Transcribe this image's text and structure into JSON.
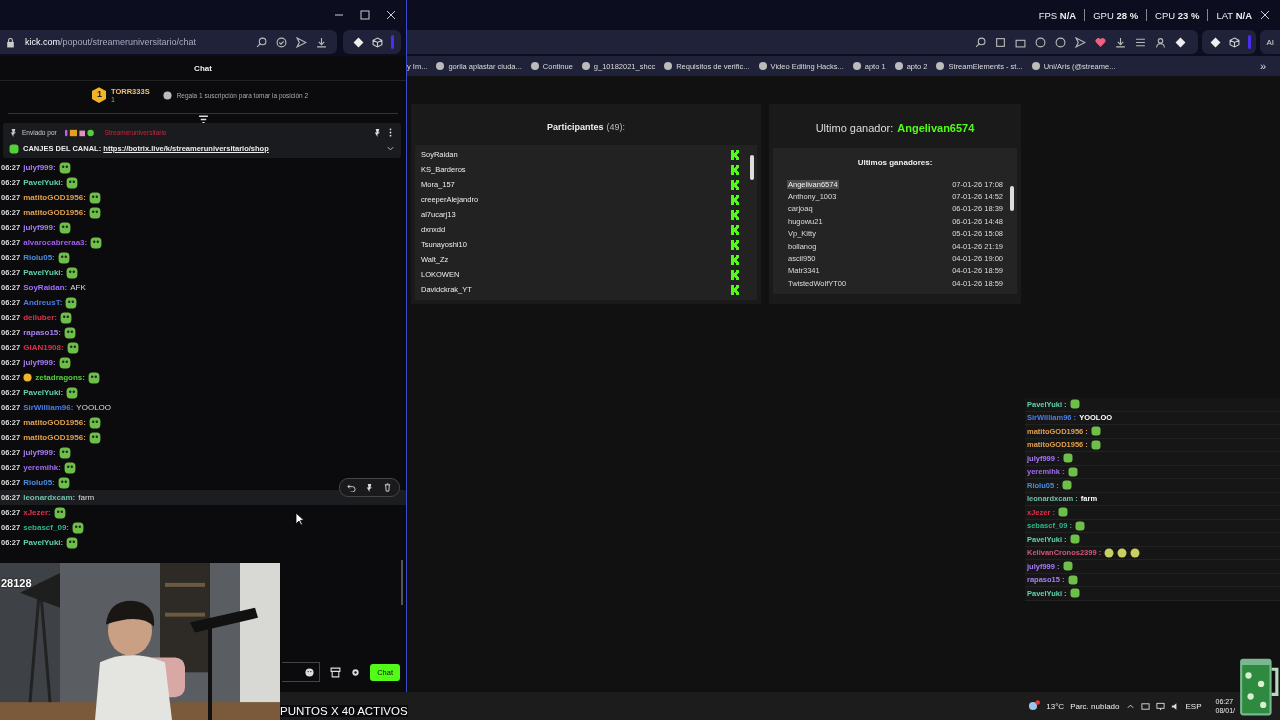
{
  "popup_window": {
    "url_domain": "kick.com",
    "url_path": "/popout/streameruniversitario/chat",
    "header": "Chat",
    "top_gifter": {
      "rank": "1",
      "name": "TORR333S",
      "count": "1",
      "prompt": "Regala 1 suscripción para tomar la posición 2"
    },
    "pinned": {
      "sent_by": "Enviado por",
      "author": "Streameruniversitario",
      "label": "CANJES DEL CANAL:",
      "link": "https://botrix.live/k/streameruniversitario/shop"
    },
    "messages": [
      {
        "time": "06:27",
        "user": "julyf999:",
        "color": "#a77cf5",
        "kind": "emote",
        "badge": false,
        "hovered": false
      },
      {
        "time": "06:27",
        "user": "PavelYuki:",
        "color": "#5fd3b0",
        "kind": "emote",
        "badge": false,
        "hovered": false
      },
      {
        "time": "06:27",
        "user": "matitoGOD1956:",
        "color": "#e0a050",
        "kind": "emote",
        "badge": false,
        "hovered": false
      },
      {
        "time": "06:27",
        "user": "matitoGOD1956:",
        "color": "#e0a050",
        "kind": "emote",
        "badge": false,
        "hovered": false
      },
      {
        "time": "06:27",
        "user": "julyf999:",
        "color": "#a77cf5",
        "kind": "emote",
        "badge": false,
        "hovered": false
      },
      {
        "time": "06:27",
        "user": "alvarocabreraa3:",
        "color": "#a05cf0",
        "kind": "emote",
        "badge": false,
        "hovered": false
      },
      {
        "time": "06:27",
        "user": "Riolu05:",
        "color": "#4a8ee0",
        "kind": "emote",
        "badge": false,
        "hovered": false
      },
      {
        "time": "06:27",
        "user": "PavelYuki:",
        "color": "#5fd3b0",
        "kind": "emote",
        "badge": false,
        "hovered": false
      },
      {
        "time": "06:27",
        "user": "SoyRaidan:",
        "color": "#a070ff",
        "kind": "text",
        "text": "AFK",
        "badge": false,
        "hovered": false
      },
      {
        "time": "06:27",
        "user": "AndreusT:",
        "color": "#4a7ee8",
        "kind": "emote",
        "badge": false,
        "hovered": false
      },
      {
        "time": "06:27",
        "user": "deiluber:",
        "color": "#e0304a",
        "kind": "emote",
        "badge": false,
        "hovered": false
      },
      {
        "time": "06:27",
        "user": "rapaso15:",
        "color": "#a680f0",
        "kind": "emote",
        "badge": false,
        "hovered": false
      },
      {
        "time": "06:27",
        "user": "GIAN1908:",
        "color": "#e0304a",
        "kind": "emote",
        "badge": false,
        "hovered": false
      },
      {
        "time": "06:27",
        "user": "julyf999:",
        "color": "#a77cf5",
        "kind": "emote",
        "badge": false,
        "hovered": false
      },
      {
        "time": "06:27",
        "user": "zetadragons:",
        "color": "#53d13a",
        "kind": "emote",
        "badge": true,
        "hovered": false
      },
      {
        "time": "06:27",
        "user": "PavelYuki:",
        "color": "#5fd3b0",
        "kind": "emote",
        "badge": false,
        "hovered": false
      },
      {
        "time": "06:27",
        "user": "SirWilliam96:",
        "color": "#4a7ee8",
        "kind": "text",
        "text": "YOOLOO",
        "badge": false,
        "hovered": false
      },
      {
        "time": "06:27",
        "user": "matitoGOD1956:",
        "color": "#e0a050",
        "kind": "emote",
        "badge": false,
        "hovered": false
      },
      {
        "time": "06:27",
        "user": "matitoGOD1956:",
        "color": "#e0a050",
        "kind": "emote",
        "badge": false,
        "hovered": false
      },
      {
        "time": "06:27",
        "user": "julyf999:",
        "color": "#a77cf5",
        "kind": "emote",
        "badge": false,
        "hovered": false
      },
      {
        "time": "06:27",
        "user": "yeremihk:",
        "color": "#a06af0",
        "kind": "emote",
        "badge": false,
        "hovered": false
      },
      {
        "time": "06:27",
        "user": "Riolu05:",
        "color": "#4a8ee0",
        "kind": "emote",
        "badge": false,
        "hovered": false
      },
      {
        "time": "06:27",
        "user": "leonardxcam:",
        "color": "#6fc0a8",
        "kind": "text",
        "text": "farm",
        "badge": false,
        "hovered": true
      },
      {
        "time": "06:27",
        "user": "xJezer:",
        "color": "#e0304a",
        "kind": "emote",
        "badge": false,
        "hovered": false
      },
      {
        "time": "06:27",
        "user": "sebascf_09:",
        "color": "#2fb58a",
        "kind": "emote",
        "badge": false,
        "hovered": false
      },
      {
        "time": "06:27",
        "user": "PavelYuki:",
        "color": "#5fd3b0",
        "kind": "emote",
        "badge": false,
        "hovered": false
      }
    ],
    "input": {
      "send_label": "Chat"
    }
  },
  "browser": {
    "stats": [
      {
        "label": "FPS",
        "value": "N/A"
      },
      {
        "label": "GPU",
        "value": "28 %"
      },
      {
        "label": "CPU",
        "value": "23 %"
      },
      {
        "label": "LAT",
        "value": "N/A"
      }
    ],
    "ai_label": "AI",
    "bookmarks": [
      "y Im...",
      "gorila aplastar ciuda...",
      "Continue",
      "g_10182021_shcc",
      "Requisitos de verific...",
      "Video Editing Hacks...",
      "apto 1",
      "apto 2",
      "StreamElements - st...",
      "Uni/Aris (@streame..."
    ],
    "more_label": "»"
  },
  "participants": {
    "title": "Participantes",
    "count": "(49):",
    "names": [
      "SoyRaidan",
      "KS_Barderos",
      "Mora_157",
      "creeperAlejandro",
      "al7ucarj13",
      "dxnxdd",
      "Tsunayoshi10",
      "Walt_Zz",
      "LOKOWEN",
      "Davidckrak_YT"
    ]
  },
  "winner": {
    "label": "Ultimo ganador:",
    "name": "Angelivan6574",
    "list_title": "Ultimos ganadores:",
    "rows": [
      {
        "name": "Angelivan6574",
        "date": "07-01-26 17:08",
        "selected": true
      },
      {
        "name": "Anthony_1003",
        "date": "07-01-26 14:52",
        "selected": false
      },
      {
        "name": "carjoaq",
        "date": "06-01-26 18:39",
        "selected": false
      },
      {
        "name": "hugowu21",
        "date": "06-01-26 14:48",
        "selected": false
      },
      {
        "name": "Vp_Kitty",
        "date": "05-01-26 15:08",
        "selected": false
      },
      {
        "name": "bollanog",
        "date": "04-01-26 21:19",
        "selected": false
      },
      {
        "name": "ascil950",
        "date": "04-01-26 19:00",
        "selected": false
      },
      {
        "name": "Matr3341",
        "date": "04-01-26 18:59",
        "selected": false
      },
      {
        "name": "TwistedWolfYT00",
        "date": "04-01-26 18:59",
        "selected": false
      }
    ]
  },
  "overlay_chat": [
    {
      "user": "PavelYuki :",
      "color": "#5fd3b0",
      "kind": "emote"
    },
    {
      "user": "SirWilliam96 :",
      "color": "#4a7ee8",
      "kind": "text",
      "text": "YOOLOO"
    },
    {
      "user": "matitoGOD1956 :",
      "color": "#e0a050",
      "kind": "emote"
    },
    {
      "user": "matitoGOD1956 :",
      "color": "#e0a050",
      "kind": "emote"
    },
    {
      "user": "julyf999 :",
      "color": "#a77cf5",
      "kind": "emote"
    },
    {
      "user": "yeremihk :",
      "color": "#a06af0",
      "kind": "emote"
    },
    {
      "user": "Riolu05 :",
      "color": "#4a8ee0",
      "kind": "emote"
    },
    {
      "user": "leonardxcam :",
      "color": "#6fc0a8",
      "kind": "text",
      "text": "farm"
    },
    {
      "user": "xJezer :",
      "color": "#e0304a",
      "kind": "emote"
    },
    {
      "user": "sebascf_09 :",
      "color": "#2fb58a",
      "kind": "emote"
    },
    {
      "user": "PavelYuki :",
      "color": "#5fd3b0",
      "kind": "emote"
    },
    {
      "user": "KelivanCronos2399 :",
      "color": "#d05a7a",
      "kind": "emote-row"
    },
    {
      "user": "julyf999 :",
      "color": "#a77cf5",
      "kind": "emote"
    },
    {
      "user": "rapaso15 :",
      "color": "#a680f0",
      "kind": "emote"
    },
    {
      "user": "PavelYuki :",
      "color": "#5fd3b0",
      "kind": "emote"
    }
  ],
  "stream_overlay": {
    "viewer_count": "28128",
    "banner": "PUNTOS X 40 ACTIVOS"
  },
  "taskbar": {
    "temperature": "13°C",
    "weather": "Parc. nublado",
    "language": "ESP",
    "time": "06:27",
    "date": "08/01/"
  }
}
